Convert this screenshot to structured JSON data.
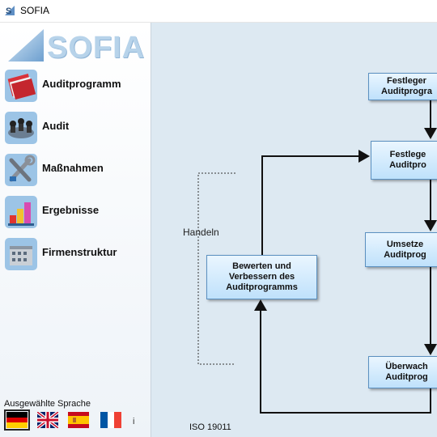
{
  "window": {
    "title": "SOFIA",
    "icon": "sofia-app-icon"
  },
  "sidebar": {
    "logo_text": "SOFIA",
    "items": [
      {
        "label": "Auditprogramm",
        "icon": "book-icon"
      },
      {
        "label": "Audit",
        "icon": "meeting-icon"
      },
      {
        "label": "Maßnahmen",
        "icon": "tools-icon"
      },
      {
        "label": "Ergebnisse",
        "icon": "bar-chart-icon"
      },
      {
        "label": "Firmenstruktur",
        "icon": "building-icon"
      }
    ],
    "language": {
      "title": "Ausgewählte Sprache",
      "flags": [
        "de-flag-icon",
        "uk-flag-icon",
        "es-flag-icon",
        "fr-flag-icon"
      ],
      "selected": "de-flag-icon",
      "info": "i"
    }
  },
  "diagram": {
    "boxes": {
      "festlegen1": "Festleger\nAuditprogra",
      "festlegen2": "Festlege\nAuditpro",
      "umsetzen": "Umsetze\nAuditprog",
      "bewerten": "Bewerten und\nVerbessern des\nAuditprogramms",
      "ueberwachen": "Überwach\nAuditprog"
    },
    "handeln_label": "Handeln",
    "iso_label": "ISO 19011"
  },
  "colors": {
    "sidebar_bg": "#eef3f8",
    "diagram_bg": "#dde9f2",
    "box_fill": "#bfe1fb",
    "box_border": "#5b90c0"
  }
}
